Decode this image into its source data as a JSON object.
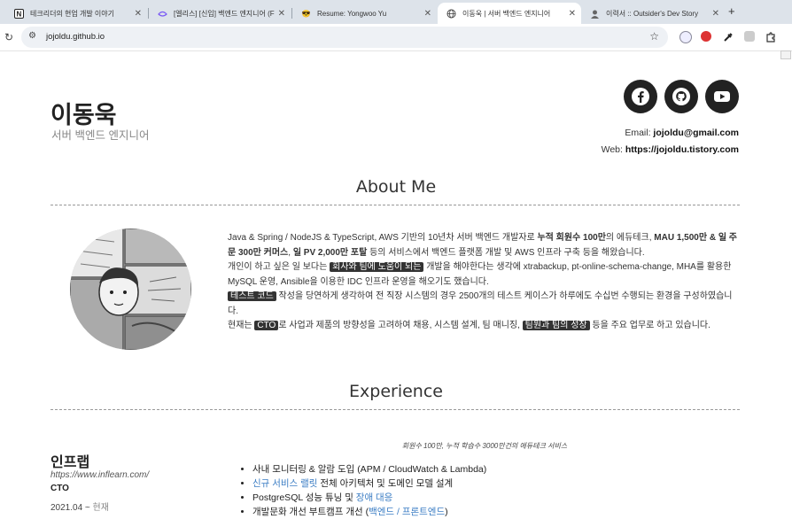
{
  "browser": {
    "tabs": [
      {
        "title": "테크리더의 현업 개발 이야기",
        "icon": "notion-icon",
        "active": false
      },
      {
        "title": "[엘리스] [신입] 백엔드 엔지니어 (F",
        "icon": "elice-icon",
        "active": false
      },
      {
        "title": "Resume: Yongwoo Yu",
        "icon": "sunglasses-icon",
        "active": false
      },
      {
        "title": "이동욱 | 서버 백엔드 엔지니어",
        "icon": "globe-icon",
        "active": true
      },
      {
        "title": "이력서 :: Outsider's Dev Story",
        "icon": "avatar-icon",
        "active": false
      }
    ],
    "url": "jojoldu.github.io"
  },
  "profile": {
    "name": "이동욱",
    "subtitle": "서버 백엔드 엔지니어",
    "email_label": "Email:",
    "email": "jojoldu@gmail.com",
    "web_label": "Web:",
    "web": "https://jojoldu.tistory.com",
    "social": [
      "facebook-icon",
      "github-icon",
      "youtube-icon"
    ]
  },
  "about": {
    "title": "About Me",
    "p1_a": "Java & Spring / NodeJS & TypeScript, AWS 기반의 10년차 서버 백엔드 개발자로 ",
    "p1_b": "누적 회원수 100만",
    "p1_c": "의 에듀테크, ",
    "p1_d": "MAU 1,500만 & 일 주문 300만 커머스",
    "p1_e": ", ",
    "p1_f": "일 PV 2,000만 포탈",
    "p1_g": " 등의 서비스에서 백엔드 플랫폼 개발 및 AWS 인프라 구축 등을 해왔습니다.",
    "p2_a": "개인이 하고 싶은 일 보다는 ",
    "p2_hl": "회사와 팀에 도움이 되는",
    "p2_b": " 개발을 해야한다는 생각에 xtrabackup, pt-online-schema-change, MHA를 활용한 MySQL 운영, Ansible을 이용한 IDC 인프라 운영을 해오기도 했습니다.",
    "p3_hl": "테스트 코드",
    "p3_b": " 작성을 당연하게 생각하여 전 직장 시스템의 경우 2500개의 테스트 케이스가 하루에도 수십번 수행되는 환경을 구성하였습니다.",
    "p4_a": "현재는 ",
    "p4_hl1": "CTO",
    "p4_b": "로 사업과 제품의 방향성을 고려하여 채용, 시스템 설계, 팀 매니징, ",
    "p4_hl2": "팀원과 팀의 성장",
    "p4_c": " 등을 주요 업무로 하고 있습니다."
  },
  "experience": {
    "title": "Experience",
    "company": "인프랩",
    "url": "https://www.inflearn.com/",
    "role": "CTO",
    "period_start": "2021.04 ~ ",
    "period_end": "현재",
    "description": "회원수 100만, 누적 학습수 3000만건의 에듀테크 서비스",
    "items": [
      {
        "text": "사내 모니터링 & 알람 도입 (APM / CloudWatch & Lambda)"
      },
      {
        "link": "신규 서비스 랠릿",
        "text": " 전체 아키텍처 및 도메인 모델 설계"
      },
      {
        "text": "PostgreSQL 성능 튜닝 및 ",
        "link2": "장애 대응"
      },
      {
        "text": "개발문화 개선 부트캠프 개선 (",
        "link2": "백엔드 / 프론트엔드",
        "tail": ")"
      }
    ]
  }
}
